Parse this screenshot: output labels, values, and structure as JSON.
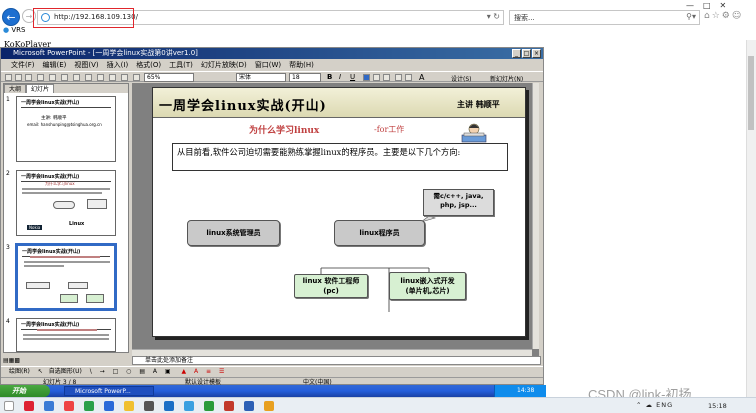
{
  "browser": {
    "url": "http://192.168.109.130/",
    "search_placeholder": "搜索...",
    "tab_label": "VRS",
    "page_title": "KoKoPlayer"
  },
  "ppt": {
    "window_title": "Microsoft PowerPoint - [一周学会linux实战第0讲ver1.0]",
    "menu": [
      "文件(F)",
      "编辑(E)",
      "视图(V)",
      "插入(I)",
      "格式(O)",
      "工具(T)",
      "幻灯片放映(D)",
      "窗口(W)",
      "帮助(H)"
    ],
    "zoom": "65%",
    "font": "宋体",
    "font_size": "18",
    "design_label": "设计(S)",
    "new_slide_label": "新幻灯片(N)",
    "pane_tabs": [
      "大纲",
      "幻灯片"
    ],
    "notes_placeholder": "单击此处添加备注",
    "draw_label": "绘图(R)",
    "autoshapes_label": "自选图形(U)",
    "status": {
      "slide": "幻灯片 3 / 8",
      "template": "默认设计模板",
      "language": "中文(中国)"
    }
  },
  "thumbs": [
    {
      "num": "1",
      "title": "一周学会linux实战(开山)",
      "lines": [
        "主讲: 韩顺平",
        "email: hanshunping@tsinghua.org.cn"
      ]
    },
    {
      "num": "2",
      "title": "一周学会linux实战(开山)",
      "lines": [
        "为什么学习linux",
        "Nokia",
        "Linux"
      ]
    },
    {
      "num": "3",
      "title": "一周学会linux实战(开山)",
      "lines": []
    },
    {
      "num": "4",
      "title": "一周学会linux实战(开山)",
      "lines": []
    }
  ],
  "slide": {
    "title": "一周学会linux实战(开山)",
    "author": "主讲 韩顺平",
    "subtitle": "为什么学习linux",
    "subtitle2": "-for工作",
    "intro": "从目前看,软件公司迫切需要能熟练掌握linux的程序员。主要是以下几个方向:",
    "node_admin": "linux系统管理员",
    "node_prog": "linux程序员",
    "callout": [
      "需c/c++, java,",
      "php, jsp..."
    ],
    "node_soft": [
      "linux 软件工程师",
      "(pc)"
    ],
    "node_embed": [
      "linux嵌入式开发",
      "(单片机,芯片)"
    ]
  },
  "xp_taskbar": {
    "start": "开始",
    "app": "Microsoft PowerP...",
    "time": "14:38"
  },
  "win10": {
    "lang": "ENG",
    "time": "15:18"
  },
  "watermark": "CSDN @link-初扬"
}
